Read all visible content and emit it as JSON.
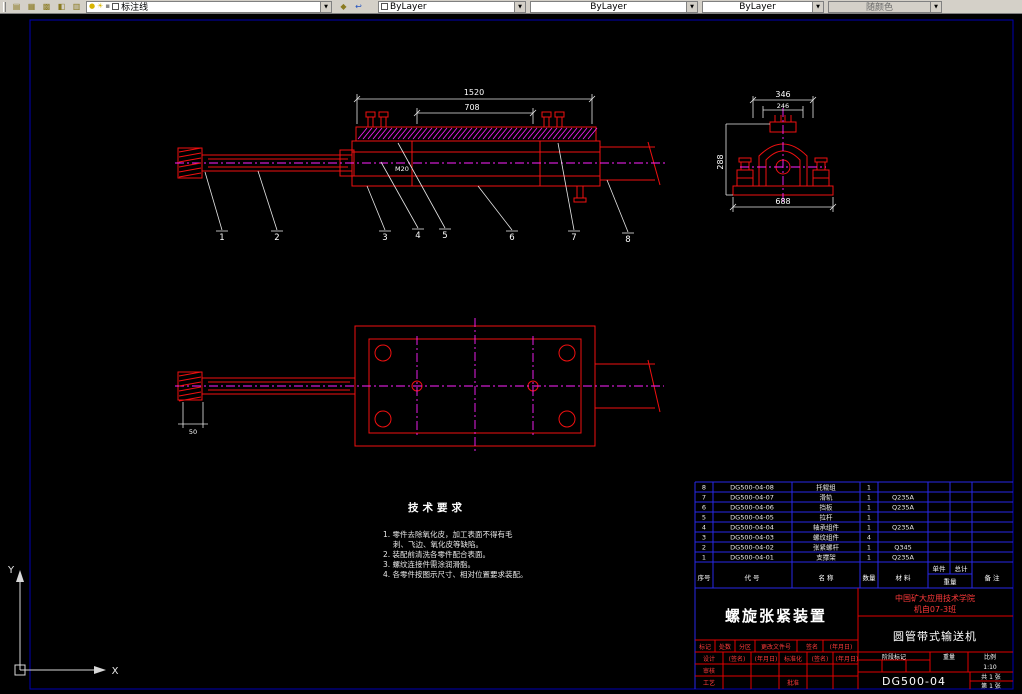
{
  "toolbar": {
    "arrow": "▼",
    "buttons": [
      {
        "glyph": "▤"
      },
      {
        "glyph": "▦"
      },
      {
        "glyph": "▩"
      },
      {
        "glyph": "◧"
      },
      {
        "glyph": "▥"
      }
    ],
    "layer_status": {
      "on": "●",
      "thaw": "☀",
      "lock": "▪"
    },
    "current_layer": "标注线",
    "make_current_glyph": "◆",
    "layer_previous_glyph": "↩",
    "color": "ByLayer",
    "linetype": "ByLayer",
    "lineweight": "ByLayer",
    "plot_style": "随颜色"
  },
  "drawing": {
    "dims": {
      "overall_length": "1520",
      "bolt_spacing": "708",
      "section_width": "346",
      "section_inner_width": "246",
      "section_height": "288",
      "section_base_width": "688",
      "rod_offset": "50",
      "thread": "M20"
    },
    "callouts": [
      "1",
      "2",
      "3",
      "4",
      "5",
      "6",
      "7",
      "8"
    ],
    "tech_title": "技术要求",
    "tech_notes": [
      "1. 零件去除氧化皮，加工表面不得有毛",
      "刺、飞边、氧化皮等缺陷。",
      "2. 装配前清洗各零件配合表面。",
      "3. 螺纹连接件需涂润滑脂。",
      "4. 各零件按图示尺寸、相对位置要求装配。"
    ],
    "ucs": {
      "x_label": "X",
      "y_label": "Y"
    }
  },
  "title_block": {
    "bom": {
      "headers": {
        "no": "序号",
        "code": "代 号",
        "name": "名 称",
        "qty": "数量",
        "material": "材 料",
        "unit_weight": "单件",
        "total_weight": "总计",
        "weight": "重量",
        "remark": "备 注"
      },
      "rows": [
        {
          "no": "8",
          "code": "DG500-04-08",
          "name": "托辊组",
          "qty": "1",
          "material": ""
        },
        {
          "no": "7",
          "code": "DG500-04-07",
          "name": "滑轨",
          "qty": "1",
          "material": "Q235A"
        },
        {
          "no": "6",
          "code": "DG500-04-06",
          "name": "挡板",
          "qty": "1",
          "material": "Q235A"
        },
        {
          "no": "5",
          "code": "DG500-04-05",
          "name": "拉杆",
          "qty": "1",
          "material": ""
        },
        {
          "no": "4",
          "code": "DG500-04-04",
          "name": "轴承组件",
          "qty": "1",
          "material": "Q235A"
        },
        {
          "no": "3",
          "code": "DG500-04-03",
          "name": "螺纹组件",
          "qty": "4",
          "material": ""
        },
        {
          "no": "2",
          "code": "DG500-04-02",
          "name": "张紧螺杆",
          "qty": "1",
          "material": "Q345"
        },
        {
          "no": "1",
          "code": "DG500-04-01",
          "name": "支撑架",
          "qty": "1",
          "material": "Q235A"
        }
      ]
    },
    "title": "螺旋张紧装置",
    "company_line1": "中国矿大应用技术学院",
    "company_line2": "机自07-3班",
    "project": "圆管带式输送机",
    "drawing_no": "DG500-04",
    "labels": {
      "stage": "阶段标记",
      "weight": "重量",
      "scale": "比例"
    },
    "scale_value": "1:10",
    "sheet_total": "共 1 张",
    "sheet_page": "第 1 张",
    "revision_row": [
      "标记",
      "处数",
      "分区",
      "更改文件号",
      "签名",
      "(年月日)"
    ],
    "design_row": [
      "设计",
      "(签名)",
      "(年月日)",
      "标准化",
      "(签名)",
      "(年月日)"
    ],
    "check_label": "审核",
    "process_label": "工艺",
    "approve_label": "批准"
  }
}
